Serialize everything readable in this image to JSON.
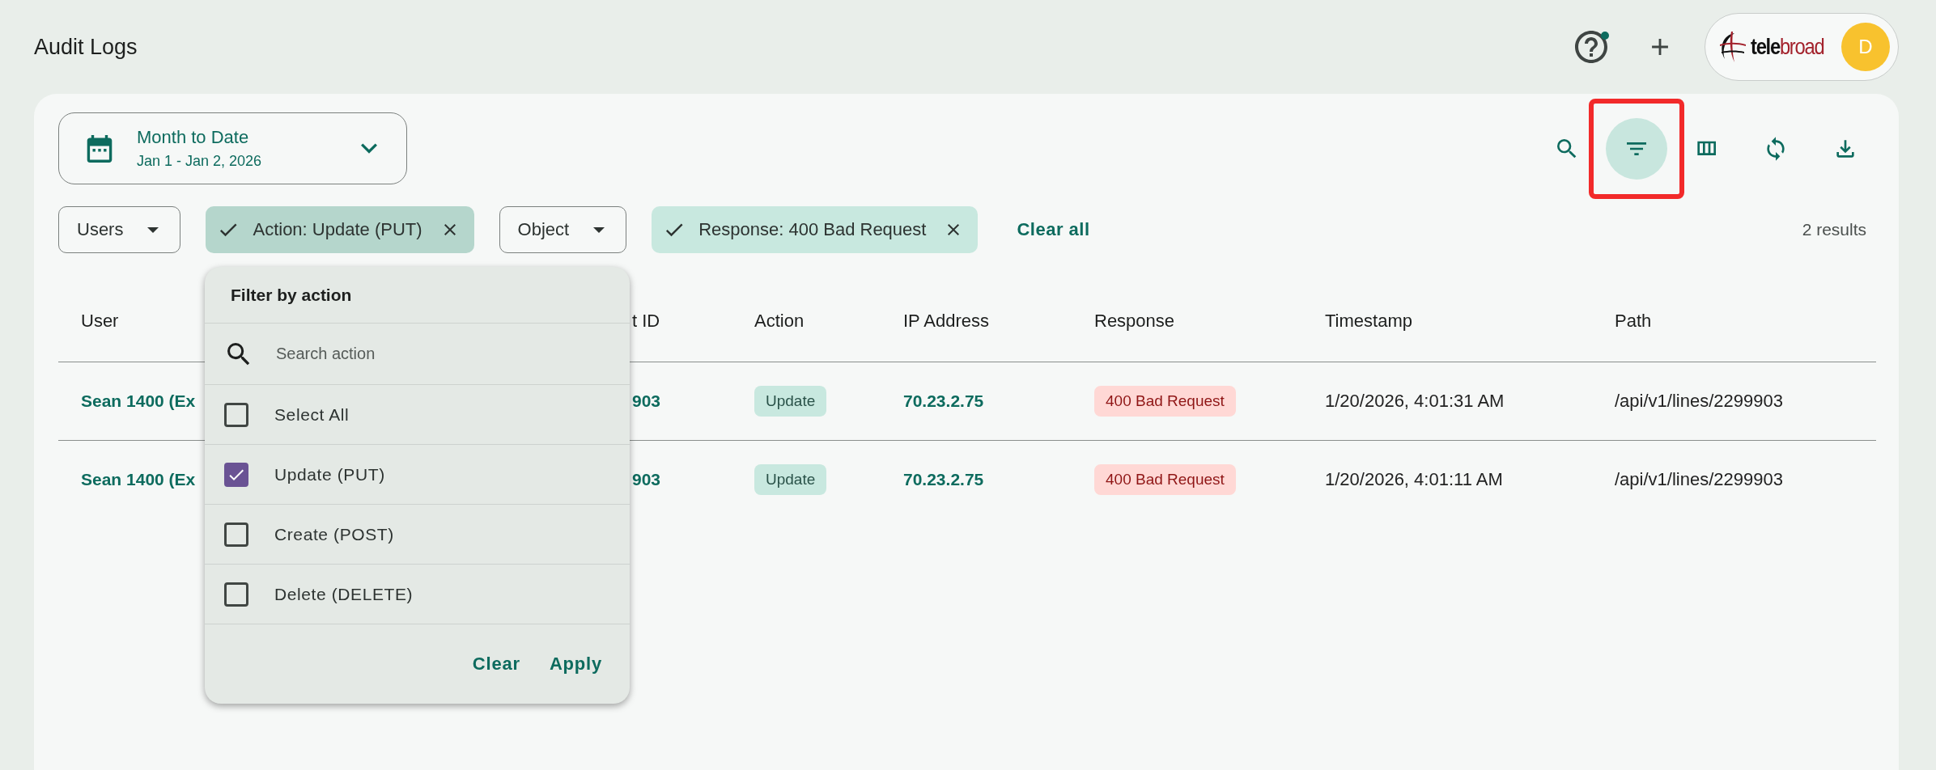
{
  "header": {
    "title": "Audit Logs"
  },
  "account": {
    "logo_parts": [
      "tele",
      "broad"
    ],
    "avatar_initial": "D"
  },
  "date_range": {
    "label": "Month to Date",
    "range": "Jan 1 - Jan 2, 2026"
  },
  "toolbar": [
    {
      "kind": "search",
      "selected": false,
      "highlighted": false
    },
    {
      "kind": "filter",
      "selected": true,
      "highlighted": true
    },
    {
      "kind": "columns",
      "selected": false,
      "highlighted": false
    },
    {
      "kind": "refresh",
      "selected": false,
      "highlighted": false
    },
    {
      "kind": "download",
      "selected": false,
      "highlighted": false
    }
  ],
  "filters": [
    {
      "kind": "dropdown",
      "label": "Users",
      "expanded": false
    },
    {
      "kind": "chip",
      "label": "Action: Update (PUT)",
      "expanded": true
    },
    {
      "kind": "dropdown",
      "label": "Object",
      "expanded": false
    },
    {
      "kind": "chip",
      "label": "Response: 400 Bad Request",
      "expanded": false
    }
  ],
  "clear_all": "Clear all",
  "result_count": "2 results",
  "action_menu": {
    "title": "Filter by action",
    "search_placeholder": "Search action",
    "options": [
      {
        "label": "Select All",
        "checked": false
      },
      {
        "label": "Update (PUT)",
        "checked": true
      },
      {
        "label": "Create (POST)",
        "checked": false
      },
      {
        "label": "Delete (DELETE)",
        "checked": false
      }
    ],
    "buttons": [
      "Clear",
      "Apply"
    ]
  },
  "table": {
    "columns": [
      "User",
      "t ID",
      "Action",
      "IP Address",
      "Response",
      "Timestamp",
      "Path"
    ],
    "rows": [
      {
        "user": "Sean 1400 (Ex",
        "column_2": "903",
        "action": "Update",
        "ip_address": "70.23.2.75",
        "response": "400 Bad Request",
        "timestamp": "1/20/2026, 4:01:31 AM",
        "path": "/api/v1/lines/2299903"
      },
      {
        "user": "Sean 1400 (Ex",
        "column_2": "903",
        "action": "Update",
        "ip_address": "70.23.2.75",
        "response": "400 Bad Request",
        "timestamp": "1/20/2026, 4:01:11 AM",
        "path": "/api/v1/lines/2299903"
      }
    ]
  }
}
